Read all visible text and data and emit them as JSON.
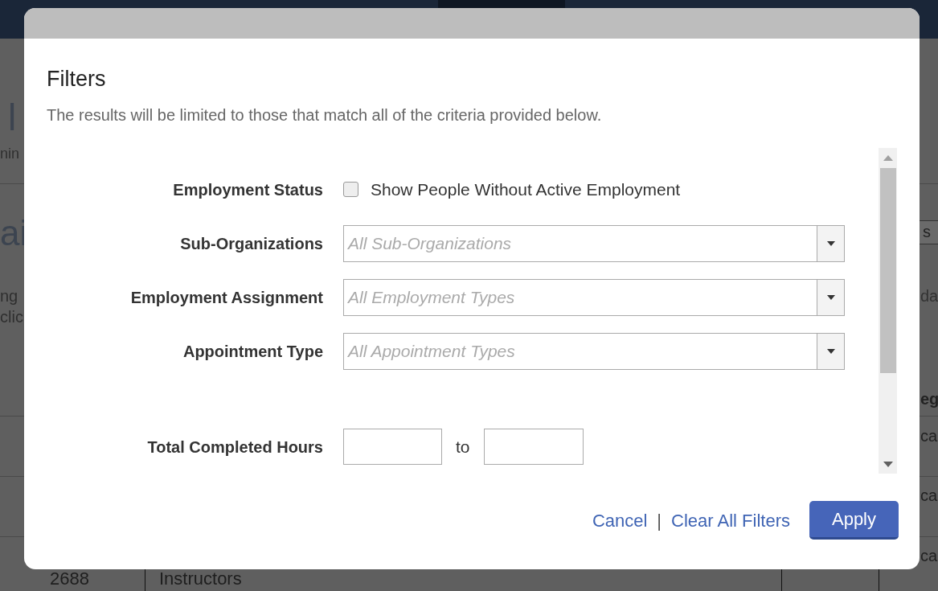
{
  "background": {
    "fragments": [
      "l",
      "nin",
      "ai",
      "ng",
      "clic",
      "s",
      "da",
      "eg",
      "ca",
      "ca",
      "ca"
    ],
    "table_row": {
      "column_1": "2688",
      "column_2": "Instructors"
    }
  },
  "modal": {
    "title": "Filters",
    "description": "The results will be limited to those that match all of the criteria provided below.",
    "fields": [
      {
        "kind": "checkbox",
        "label": "Employment Status",
        "option": "Show People Without Active Employment",
        "checked": false
      },
      {
        "kind": "select",
        "label": "Sub-Organizations",
        "placeholder": "All Sub-Organizations"
      },
      {
        "kind": "select",
        "label": "Employment Assignment",
        "placeholder": "All Employment Types"
      },
      {
        "kind": "select",
        "label": "Appointment Type",
        "placeholder": "All Appointment Types"
      },
      {
        "kind": "range",
        "label": "Total Completed Hours",
        "separator": "to"
      }
    ],
    "footer": {
      "cancel": "Cancel",
      "divider": "|",
      "clear": "Clear All Filters",
      "apply": "Apply"
    }
  }
}
